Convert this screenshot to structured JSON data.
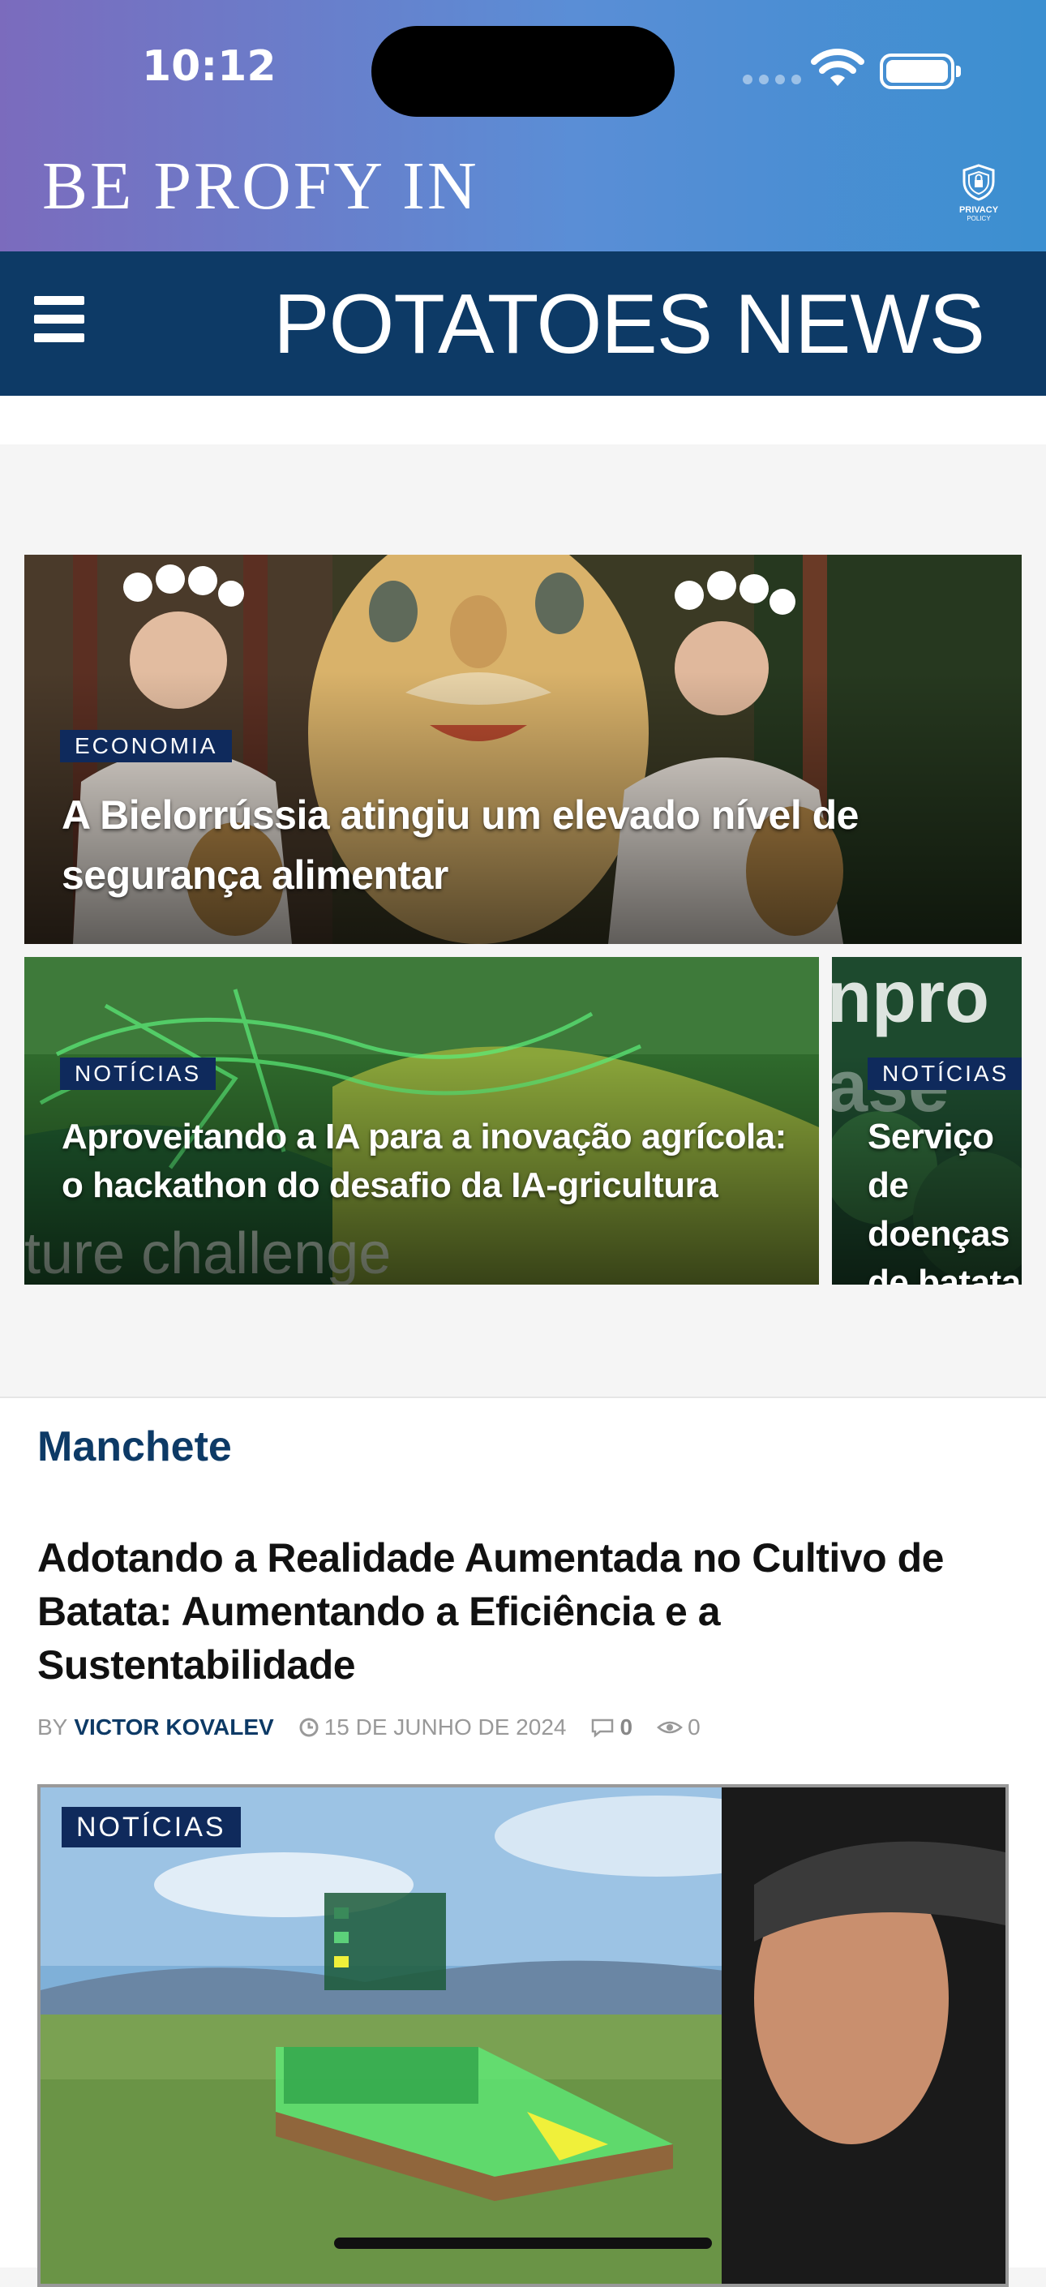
{
  "status": {
    "time": "10:12"
  },
  "brand": {
    "title": "BE PROFY IN",
    "privacy_line1": "PRIVACY",
    "privacy_line2": "POLICY"
  },
  "nav": {
    "title": "POTATOES NEWS"
  },
  "featured": [
    {
      "tag": "ECONOMIA",
      "title": "A Bielorrússia atingiu um elevado nível de segurança alimentar"
    },
    {
      "tag": "NOTÍCIAS",
      "title": "Aproveitando a IA para a inovação agrícola: o hackathon do desafio da IA-gricultura"
    },
    {
      "tag": "NOTÍCIAS",
      "title": "Serviço de doenças de batata"
    }
  ],
  "section": {
    "heading": "Manchete",
    "headline": "Adotando a Realidade Aumentada no Cultivo de Batata: Aumentando a Eficiência e a Sustentabilidade",
    "by": "BY",
    "author": "VICTOR KOVALEV",
    "date": "15 DE JUNHO DE 2024",
    "comments": "0",
    "views": "0",
    "hero_tag": "NOTÍCIAS"
  },
  "colors": {
    "navy": "#0d3a66",
    "tag_bg": "#0f2a5c"
  }
}
